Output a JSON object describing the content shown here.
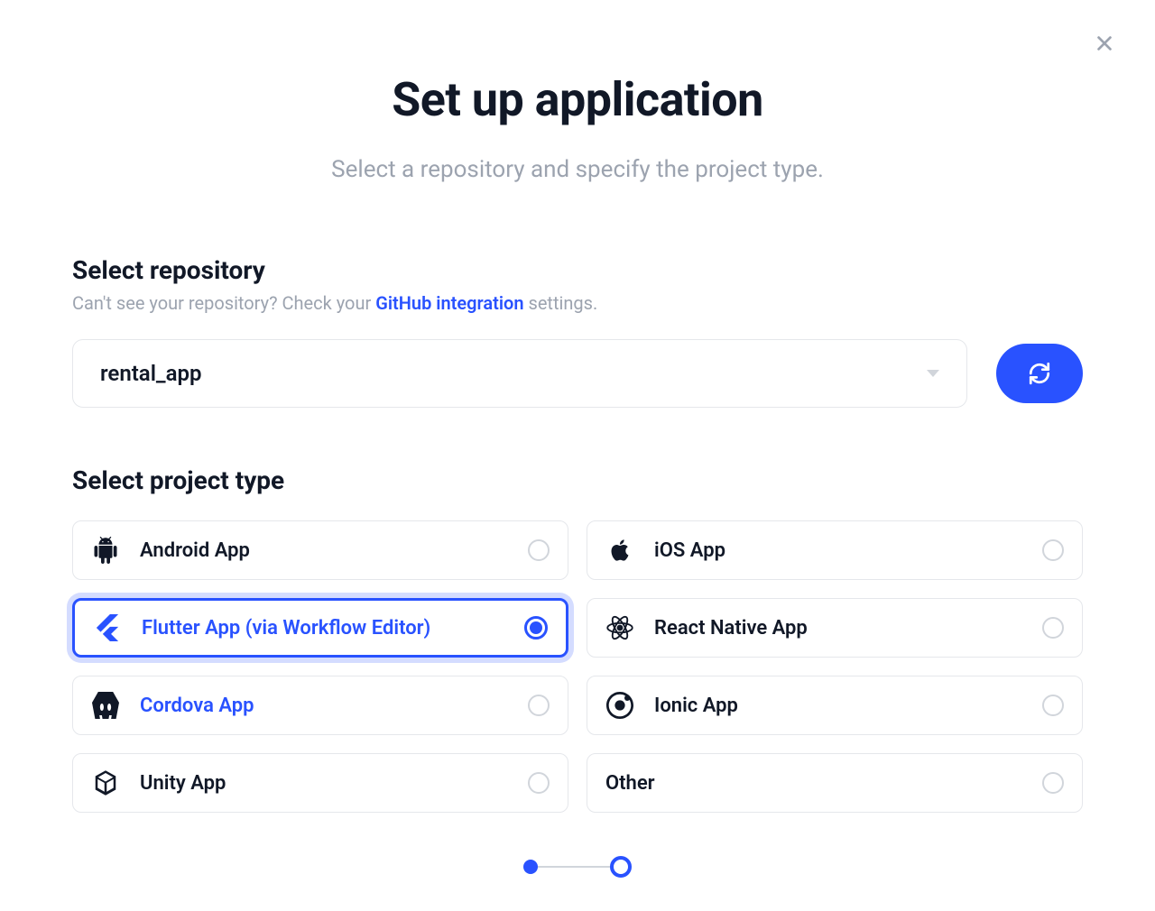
{
  "header": {
    "title": "Set up application",
    "subtitle": "Select a repository and specify the project type."
  },
  "repository": {
    "section_title": "Select repository",
    "hint_prefix": "Can't see your repository? Check your ",
    "hint_link": "GitHub integration",
    "hint_suffix": " settings.",
    "selected": "rental_app"
  },
  "project_type": {
    "section_title": "Select project type",
    "selected_index": 2,
    "items": [
      {
        "icon": "android",
        "label": "Android App",
        "highlight": false
      },
      {
        "icon": "apple",
        "label": "iOS App",
        "highlight": false
      },
      {
        "icon": "flutter",
        "label": "Flutter App (via Workflow Editor)",
        "highlight": true
      },
      {
        "icon": "react",
        "label": "React Native App",
        "highlight": false
      },
      {
        "icon": "cordova",
        "label": "Cordova App",
        "highlight": true
      },
      {
        "icon": "ionic",
        "label": "Ionic App",
        "highlight": false
      },
      {
        "icon": "unity",
        "label": "Unity App",
        "highlight": false
      },
      {
        "icon": "other",
        "label": "Other",
        "highlight": false
      }
    ]
  },
  "stepper": {
    "current": 1,
    "total": 2
  }
}
